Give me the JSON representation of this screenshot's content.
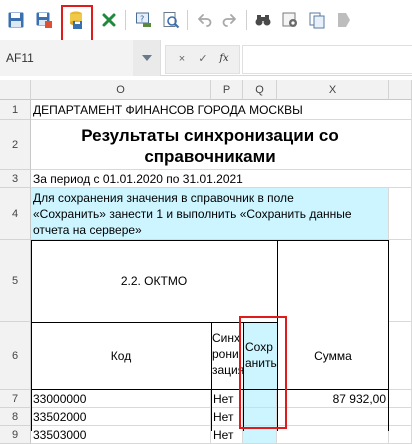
{
  "toolbar": {
    "buttons": [
      "save-icon",
      "save-as-icon",
      "server-save-icon",
      "excel-export-icon",
      "search-help-icon",
      "preview-icon",
      "undo-icon",
      "redo-icon",
      "find-icon",
      "settings-icon",
      "copy-icon",
      "bookmark-icon"
    ],
    "highlight_color": "#e01b1b"
  },
  "formula_bar": {
    "cell_ref": "AF11",
    "cancel": "×",
    "confirm": "✓",
    "fx": "fx",
    "value": ""
  },
  "grid": {
    "columns": [
      "O",
      "P",
      "Q",
      "X"
    ],
    "rows": [
      "1",
      "2",
      "3",
      "4",
      "5",
      "6",
      "7",
      "8",
      "9"
    ],
    "row1_text": "ДЕПАРТАМЕНТ ФИНАНСОВ ГОРОДА МОСКВЫ",
    "title_line1": "Результаты синхронизации со",
    "title_line2": "справочниками",
    "period": "За период с 01.01.2020 по 31.01.2021",
    "note_line1": "Для сохранения значения в справочник в поле",
    "note_line2": "«Сохранить» занести 1 и выполнить «Сохранить данные",
    "note_line3": "отчета на сервере»",
    "section": "2.2. ОКТМО",
    "headers": {
      "code": "Код",
      "sync_l1": "Синх",
      "sync_l2": "рони",
      "sync_l3": "зация",
      "save_l1": "Сохр",
      "save_l2": "анить",
      "sum": "Сумма"
    },
    "data_rows": [
      {
        "code": "33000000",
        "sync": "Нет",
        "save": "",
        "sum": "87 932,00"
      },
      {
        "code": "33502000",
        "sync": "Нет",
        "save": "",
        "sum": ""
      },
      {
        "code": "33503000",
        "sync": "Нет",
        "save": "",
        "sum": ""
      }
    ],
    "note_bg": "#ccf5ff",
    "save_col_bg": "#ccf5ff"
  }
}
